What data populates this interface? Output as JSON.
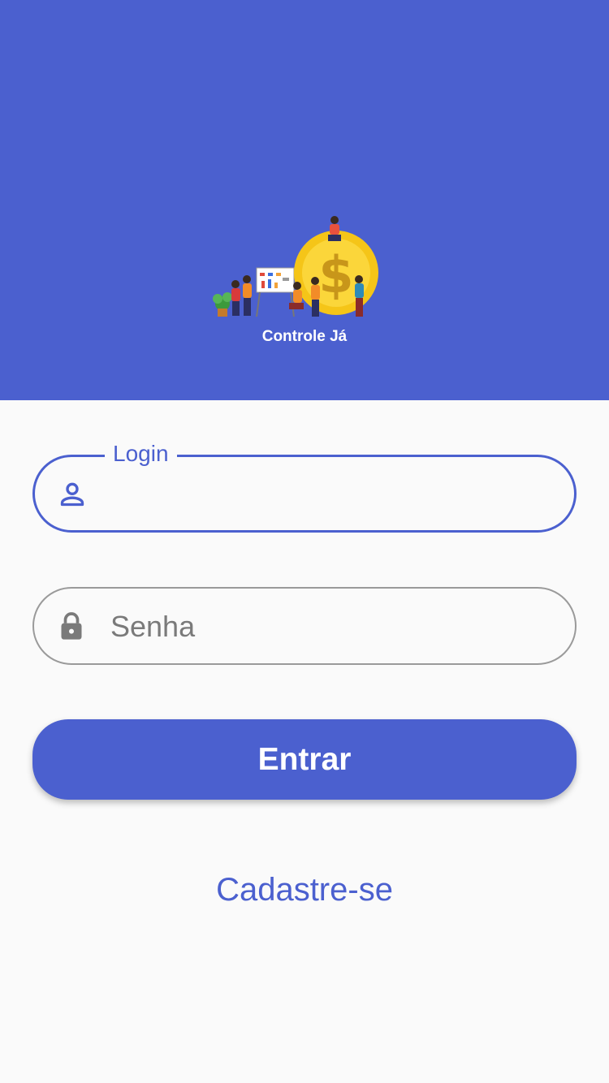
{
  "header": {
    "logo_text": "Controle Já",
    "background_color": "#4b60cf"
  },
  "login_field": {
    "label": "Login",
    "value": "",
    "icon": "person-icon"
  },
  "senha_field": {
    "placeholder": "Senha",
    "value": "",
    "icon": "lock-icon"
  },
  "actions": {
    "entrar_label": "Entrar",
    "cadastro_label": "Cadastre-se"
  },
  "colors": {
    "accent": "#4b60cf",
    "background": "#fafafa",
    "muted_border": "#9a9a9a"
  }
}
